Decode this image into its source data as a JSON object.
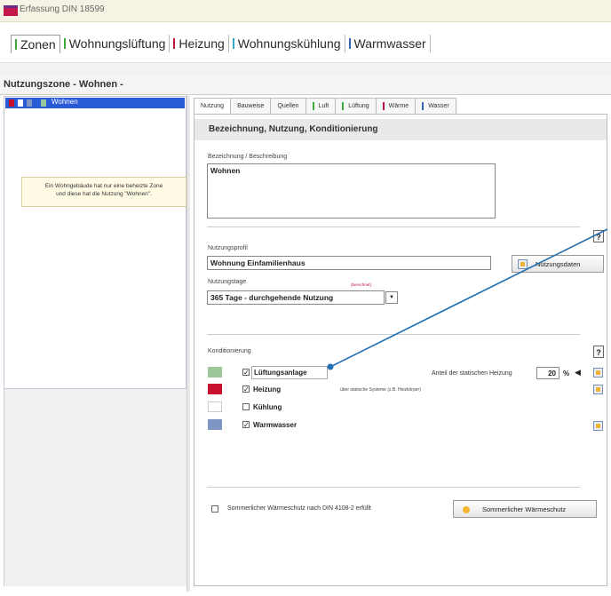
{
  "window": {
    "title": "Erfassung DIN 18599"
  },
  "main_tabs": [
    {
      "label": "Zonen",
      "color": "#3caa3c",
      "active": true
    },
    {
      "label": "Wohnungslüftung",
      "color": "#3caa3c"
    },
    {
      "label": "Heizung",
      "color": "#c0143c"
    },
    {
      "label": "Wohnungskühlung",
      "color": "#33a9c8"
    },
    {
      "label": "Warmwasser",
      "color": "#3366b5"
    }
  ],
  "zone_header": "Nutzungszone  -  Wohnen  -",
  "zone_list": {
    "selected_item": "Wohnen"
  },
  "note": {
    "line1": "Ein Wohngebäude hat nur eine beheizte Zone",
    "line2": "und diese hat die Nutzung \"Wohnen\"."
  },
  "sub_tabs": [
    {
      "label": "Nutzung",
      "color": ""
    },
    {
      "label": "Bauweise",
      "color": ""
    },
    {
      "label": "Quellen",
      "color": ""
    },
    {
      "label": "Luft",
      "color": "#3caa3c"
    },
    {
      "label": "Lüftung",
      "color": "#3caa3c"
    },
    {
      "label": "Wärme",
      "color": "#c0143c"
    },
    {
      "label": "Wasser",
      "color": "#3366b5"
    }
  ],
  "section_title": "Bezeichnung,  Nutzung,  Konditionierung",
  "bezeichnung": {
    "label": "Bezeichnung / Beschreibung",
    "value": "Wohnen"
  },
  "nutzungsprofil": {
    "label": "Nutzungsprofil",
    "value": "Wohnung Einfamilienhaus",
    "button": "Nutzungsdaten"
  },
  "nutzungstage": {
    "label": "Nutzungstage",
    "value": "365 Tage  -  durchgehende Nutzung",
    "hint": "(berechnet)"
  },
  "help_label": "?",
  "konditionierung": {
    "label": "Konditionierung",
    "items": [
      {
        "label": "Lüftungsanlage",
        "color": "#9bc79b",
        "checked": true
      },
      {
        "label": "Heizung",
        "color": "#c8102e",
        "checked": true
      },
      {
        "label": "Kühlung",
        "color": "#ffffff",
        "checked": false
      },
      {
        "label": "Warmwasser",
        "color": "#7f96c3",
        "checked": true
      }
    ],
    "static_heating_label": "Anteil der statischen Heizung",
    "static_heating_value": "20",
    "static_heating_unit": "%",
    "heating_note": "über statische Systeme (z.B. Heizkörper)"
  },
  "summer": {
    "checkbox_label": "Sommerlicher Wärmeschutz nach DIN 4108-2 erfüllt",
    "button": "Sommerlicher Wärmeschutz"
  },
  "checkmark": "✓"
}
